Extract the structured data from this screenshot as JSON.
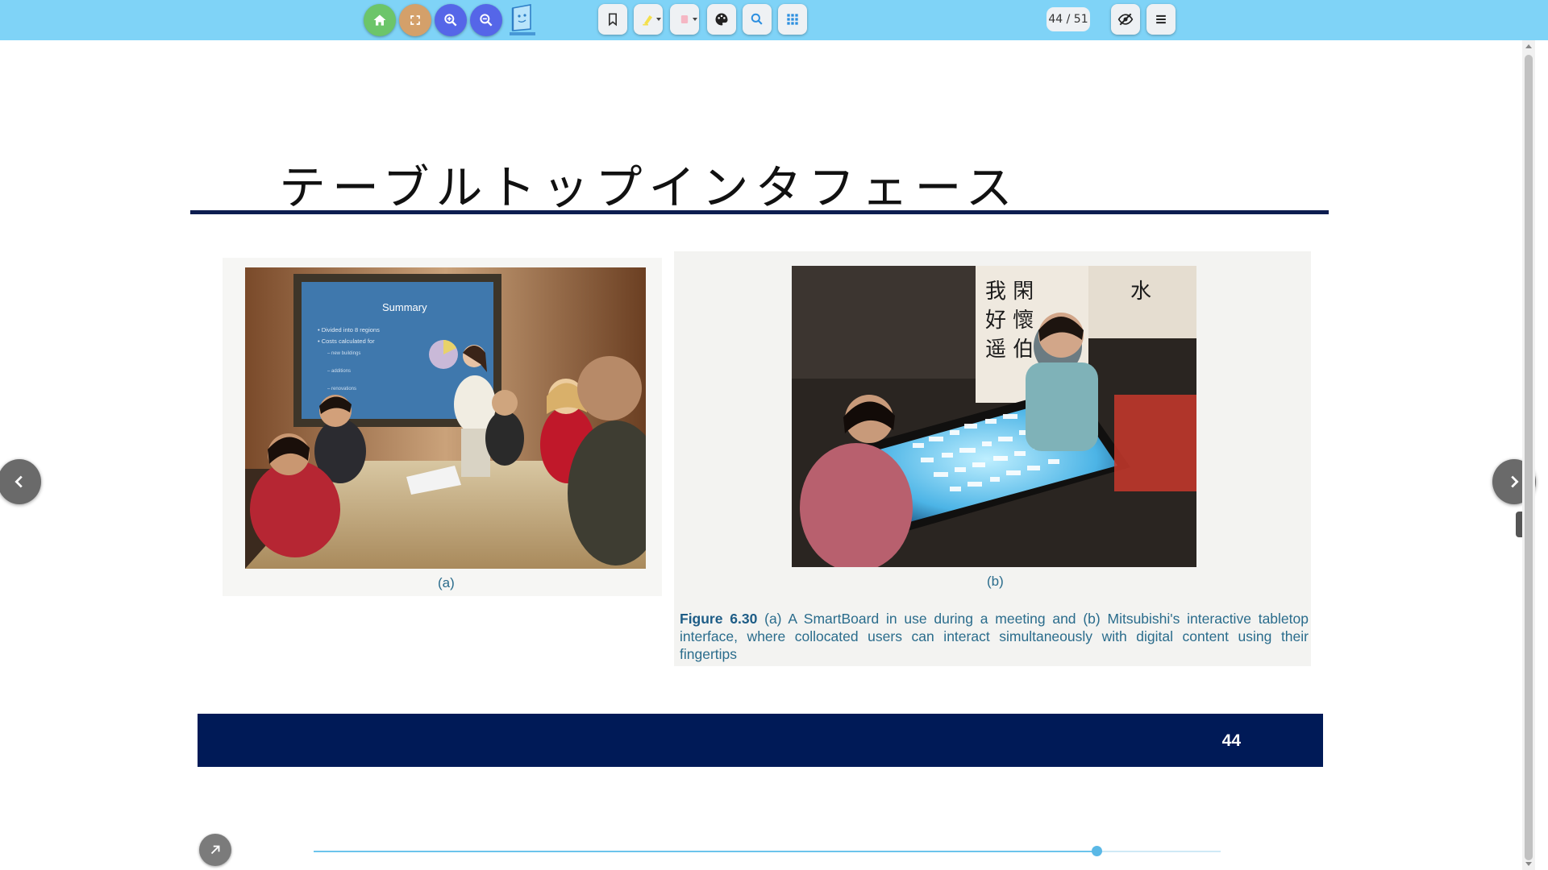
{
  "toolbar": {
    "page_counter": "44 / 51",
    "colors": {
      "home": "#6cc56a",
      "fullscreen": "#d4a06a",
      "zoom_in": "#5566e8",
      "zoom_out": "#5566e8",
      "bar": "#7fd3f7"
    },
    "icons": [
      "home-icon",
      "fullscreen-icon",
      "zoom-in-icon",
      "zoom-out-icon",
      "logo-icon",
      "bookmark-icon",
      "highlighter-icon",
      "eraser-icon",
      "palette-icon",
      "search-icon",
      "grid-icon",
      "eye-off-icon",
      "menu-icon"
    ]
  },
  "slide": {
    "title": "テーブルトップインタフェース",
    "photo_a": {
      "screen_title": "Summary",
      "screen_lines": [
        "• Divided into 8 regions",
        "• Costs calculated for",
        "– new buildings",
        "– additions",
        "– renovations"
      ],
      "caption": "(a)"
    },
    "photo_b": {
      "caption": "(b)"
    },
    "figure_caption": {
      "label": "Figure 6.30",
      "text": " (a) A SmartBoard in use during a meeting and (b) Mitsubishi's interactive tabletop interface, where collocated users can interact simultaneously with digital content using their fingertips"
    },
    "page_number": "44",
    "colors": {
      "rule": "#0d1d50",
      "footer": "#001a57",
      "caption": "#2a6c8c"
    }
  },
  "progress": {
    "current_page": 44,
    "total_pages": 51,
    "fraction": 0.863
  },
  "side_tab": "F"
}
